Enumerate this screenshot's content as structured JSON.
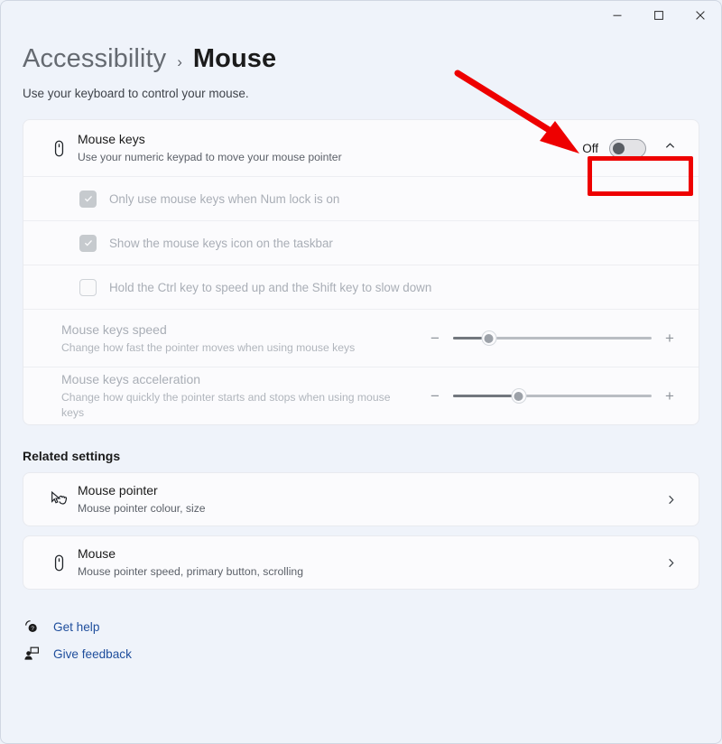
{
  "window": {
    "controls": [
      {
        "name": "minimize",
        "glyph": "minimize-icon"
      },
      {
        "name": "maximize",
        "glyph": "maximize-icon"
      },
      {
        "name": "close",
        "glyph": "close-icon"
      }
    ]
  },
  "header": {
    "breadcrumb_parent": "Accessibility",
    "breadcrumb_separator": "›",
    "breadcrumb_current": "Mouse",
    "subtitle": "Use your keyboard to control your mouse."
  },
  "mouse_keys": {
    "icon": "mouse-icon",
    "title": "Mouse keys",
    "subtitle": "Use your numeric keypad to move your mouse pointer",
    "toggle_label": "Off",
    "toggle_state": "off",
    "expander_icon": "chevron-up-icon",
    "checkboxes": [
      {
        "label": "Only use mouse keys when Num lock is on",
        "checked": true,
        "disabled": true
      },
      {
        "label": "Show the mouse keys icon on the taskbar",
        "checked": true,
        "disabled": true
      },
      {
        "label": "Hold the Ctrl key to speed up and the Shift key to slow down",
        "checked": false,
        "disabled": true
      }
    ],
    "sliders": [
      {
        "title": "Mouse keys speed",
        "subtitle": "Change how fast the pointer moves when using mouse keys",
        "value_percent": 18,
        "minus_label": "−",
        "plus_label": "+",
        "disabled": true
      },
      {
        "title": "Mouse keys acceleration",
        "subtitle": "Change how quickly the pointer starts and stops when using mouse keys",
        "value_percent": 33,
        "minus_label": "−",
        "plus_label": "+",
        "disabled": true
      }
    ]
  },
  "related_settings": {
    "section_title": "Related settings",
    "items": [
      {
        "icon": "mouse-pointer-icon",
        "title": "Mouse pointer",
        "subtitle": "Mouse pointer colour, size",
        "chevron": "chevron-right-icon"
      },
      {
        "icon": "mouse-icon",
        "title": "Mouse",
        "subtitle": "Mouse pointer speed, primary button, scrolling",
        "chevron": "chevron-right-icon"
      }
    ]
  },
  "footer": {
    "links": [
      {
        "icon": "help-icon",
        "label": "Get help"
      },
      {
        "icon": "feedback-icon",
        "label": "Give feedback"
      }
    ]
  },
  "annotations": {
    "arrow_color": "#ee0000",
    "highlight_color": "#ee0000",
    "highlight_target": "mouse-keys-toggle"
  }
}
